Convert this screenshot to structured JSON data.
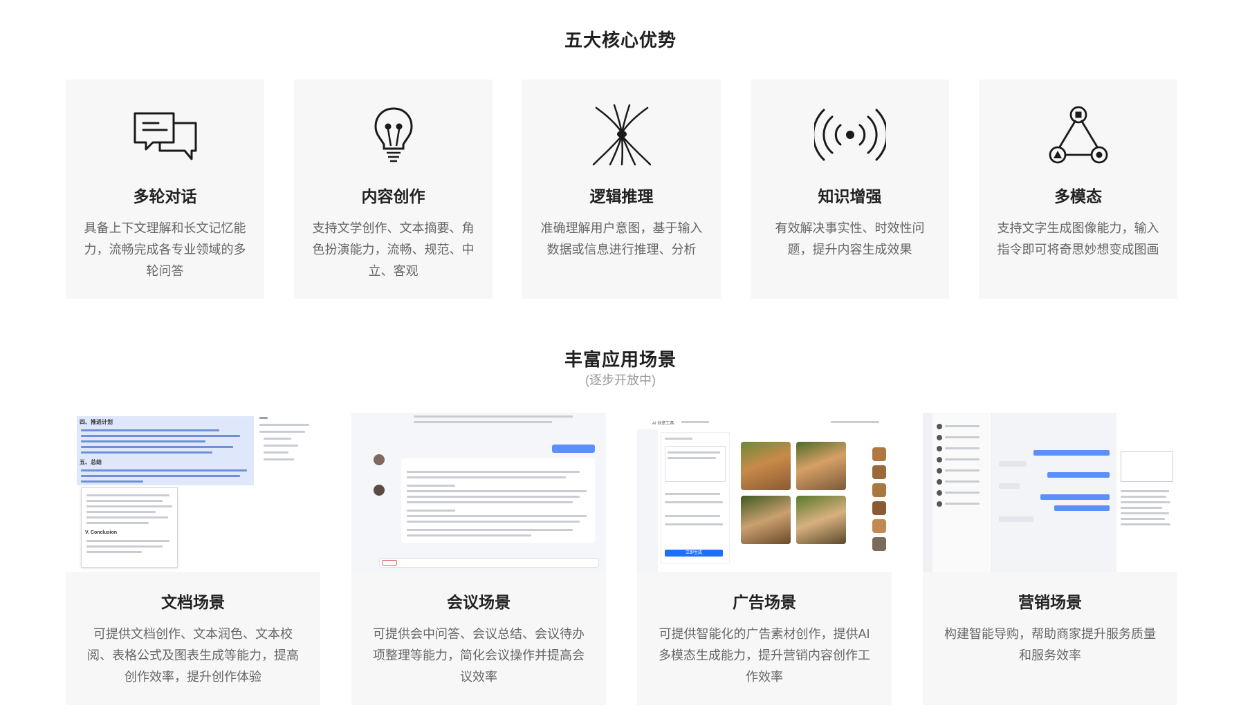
{
  "advantages": {
    "title": "五大核心优势",
    "cards": [
      {
        "icon": "chat-bubbles-icon",
        "title": "多轮对话",
        "desc": "具备上下文理解和长文记忆能力，流畅完成各专业领域的多轮问答"
      },
      {
        "icon": "lightbulb-icon",
        "title": "内容创作",
        "desc": "支持文学创作、文本摘要、角色扮演能力，流畅、规范、中立、客观"
      },
      {
        "icon": "neural-node-icon",
        "title": "逻辑推理",
        "desc": "准确理解用户意图，基于输入数据或信息进行推理、分析"
      },
      {
        "icon": "broadcast-signal-icon",
        "title": "知识增强",
        "desc": "有效解决事实性、时效性问题，提升内容生成效果"
      },
      {
        "icon": "multimodal-triangle-icon",
        "title": "多模态",
        "desc": "支持文字生成图像能力，输入指令即可将奇思妙想变成图画"
      }
    ]
  },
  "scenarios": {
    "title": "丰富应用场景",
    "subtitle": "(逐步开放中)",
    "cards": [
      {
        "title": "文档场景",
        "desc": "可提供文档创作、文本润色、文本校阅、表格公式及图表生成等能力，提高创作效率，提升创作体验"
      },
      {
        "title": "会议场景",
        "desc": "可提供会中问答、会议总结、会议待办项整理等能力，简化会议操作并提高会议效率"
      },
      {
        "title": "广告场景",
        "desc": "可提供智能化的广告素材创作，提供AI多模态生成能力，提升营销内容创作工作效率"
      },
      {
        "title": "营销场景",
        "desc": "构建智能导购，帮助商家提升服务质量和服务效率"
      }
    ],
    "doc_shot": {
      "section_plan": "四、推进计划",
      "section_summary": "五、总结",
      "conclusion": "V. Conclusion"
    },
    "ad_shot": {
      "app_name": "AI 创意工具",
      "generate_label": "立即生成"
    }
  }
}
